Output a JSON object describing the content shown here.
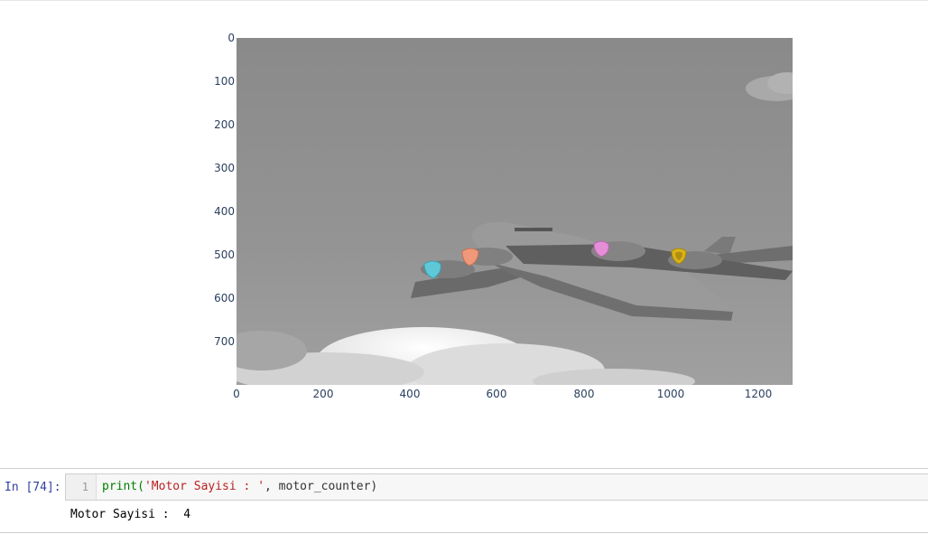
{
  "plot": {
    "x_ticks": [
      "0",
      "200",
      "400",
      "600",
      "800",
      "1000",
      "1200"
    ],
    "y_ticks": [
      "0",
      "100",
      "200",
      "300",
      "400",
      "500",
      "600",
      "700"
    ],
    "marker_colors": [
      "#5fc8d6",
      "#f0997a",
      "#e58ed8",
      "#d9b417"
    ],
    "image_description_icon": "airplane-grayscale-image"
  },
  "cell": {
    "prompt": "In [74]:",
    "line_number": "1",
    "code_func": "print(",
    "code_string": "'Motor Sayisi : '",
    "code_rest": ", motor_counter)"
  },
  "output": {
    "text": "Motor Sayisi :  4"
  }
}
